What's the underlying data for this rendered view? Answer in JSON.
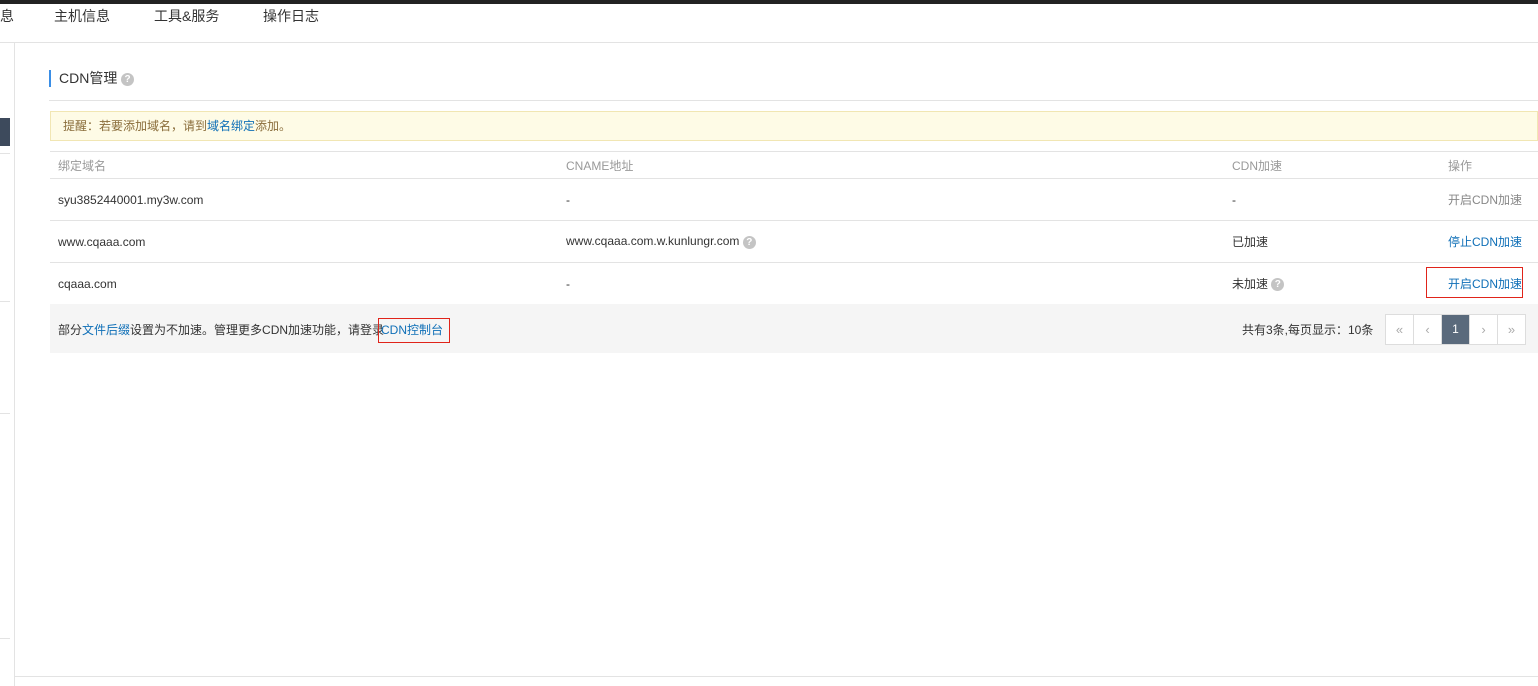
{
  "nav": {
    "tabs": [
      {
        "label": "息"
      },
      {
        "label": "主机信息"
      },
      {
        "label": "工具&服务"
      },
      {
        "label": "操作日志"
      }
    ]
  },
  "section": {
    "title": "CDN管理",
    "help_icon": "?"
  },
  "notice": {
    "prefix": "提醒：若要添加域名，请到",
    "link": "域名绑定",
    "suffix": "添加。"
  },
  "table": {
    "headers": [
      "绑定域名",
      "CNAME地址",
      "CDN加速",
      "操作"
    ],
    "rows": [
      {
        "domain": "syu3852440001.my3w.com",
        "cname": "-",
        "cdn": "-",
        "action": "开启CDN加速"
      },
      {
        "domain": "www.cqaaa.com",
        "cname": "www.cqaaa.com.w.kunlungr.com",
        "cdn": "已加速",
        "action": "停止CDN加速"
      },
      {
        "domain": "cqaaa.com",
        "cname": "-",
        "cdn": "未加速",
        "action": "开启CDN加速"
      }
    ]
  },
  "footer": {
    "text_prefix": "部分",
    "link1": "文件后缀",
    "text_mid": "设置为不加速。管理更多CDN加速功能，请登录",
    "link2": "CDN控制台",
    "page_info": "共有3条,每页显示：10条"
  },
  "pager": {
    "first": "«",
    "prev": "‹",
    "current": "1",
    "next": "›",
    "last": "»"
  },
  "colors": {
    "link": "#0f6fb7",
    "highlight_border": "#e0241a",
    "pager_active": "#5a6a7c",
    "notice_bg": "#fefbe6"
  }
}
